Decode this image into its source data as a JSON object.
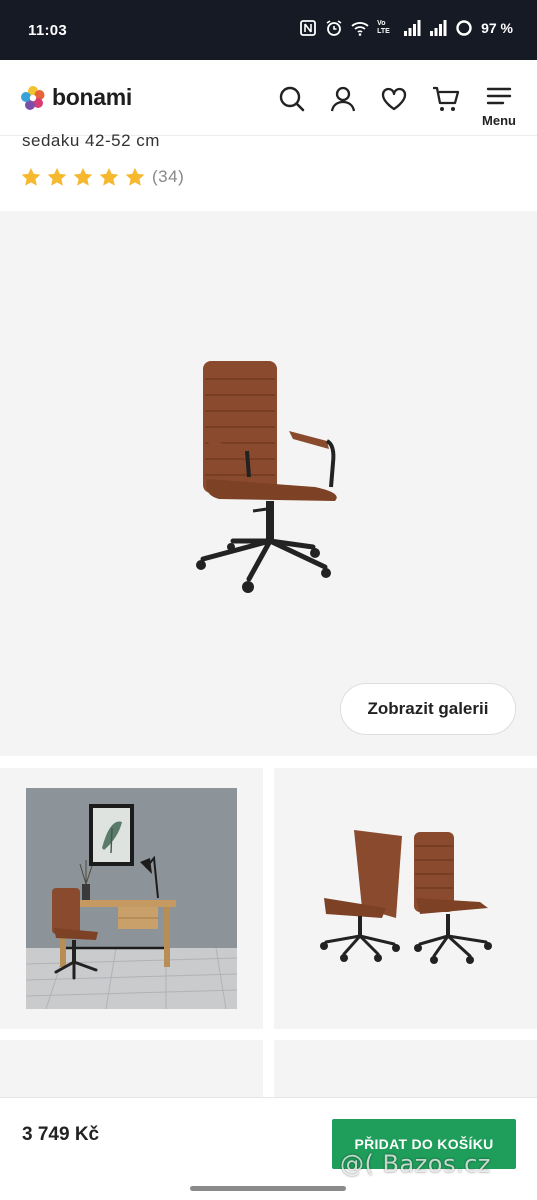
{
  "statusbar": {
    "time": "11:03",
    "volte": "Vo LTE",
    "battery": "97 %"
  },
  "header": {
    "logo_text": "bonami",
    "menu_label": "Menu",
    "icons": [
      "search-icon",
      "user-icon",
      "heart-icon",
      "cart-icon",
      "hamburger-icon"
    ]
  },
  "product": {
    "subtitle": "sedaku 42-52 cm",
    "rating_stars": 5,
    "rating_count": "(34)",
    "star_color": "#f5b82e"
  },
  "gallery": {
    "button_label": "Zobrazit galerii"
  },
  "purchase": {
    "price": "3 749 Kč",
    "cta_label": "PŘIDAT DO KOŠÍKU",
    "cta_color": "#1f9d5a"
  },
  "watermark": "@( Bazos.cz"
}
